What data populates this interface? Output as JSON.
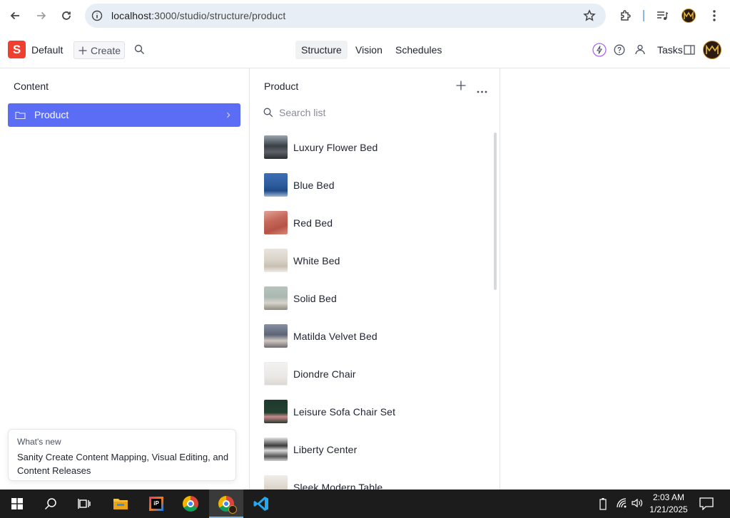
{
  "browser": {
    "url_host": "localhost",
    "url_path": ":3000/studio/structure/product",
    "icons": [
      "back-icon",
      "forward-icon",
      "reload-icon",
      "site-info-icon",
      "bookmark-star-icon",
      "extensions-icon",
      "media-control-icon",
      "profile-avatar-icon",
      "menu-kebab-icon"
    ]
  },
  "studio": {
    "logo_letter": "S",
    "workspace_name": "Default",
    "create_label": "Create",
    "tools": [
      "Structure",
      "Vision",
      "Schedules"
    ],
    "active_tool": "Structure",
    "tasks_label": "Tasks",
    "accent": "#5b6cf5",
    "brand": "#f03e2f"
  },
  "content_pane": {
    "title": "Content",
    "items": [
      {
        "label": "Product",
        "selected": true
      }
    ]
  },
  "product_pane": {
    "title": "Product",
    "search_placeholder": "Search list",
    "items": [
      {
        "name": "Luxury Flower Bed"
      },
      {
        "name": "Blue Bed"
      },
      {
        "name": "Red Bed"
      },
      {
        "name": "White Bed"
      },
      {
        "name": "Solid Bed"
      },
      {
        "name": "Matilda Velvet Bed"
      },
      {
        "name": "Diondre Chair"
      },
      {
        "name": "Leisure Sofa Chair Set"
      },
      {
        "name": "Liberty Center"
      },
      {
        "name": "Sleek Modern Table"
      }
    ]
  },
  "whats_new": {
    "title": "What's new",
    "body": "Sanity Create Content Mapping, Visual Editing, and Content Releases"
  },
  "taskbar": {
    "time": "2:03 AM",
    "date": "1/21/2025"
  }
}
